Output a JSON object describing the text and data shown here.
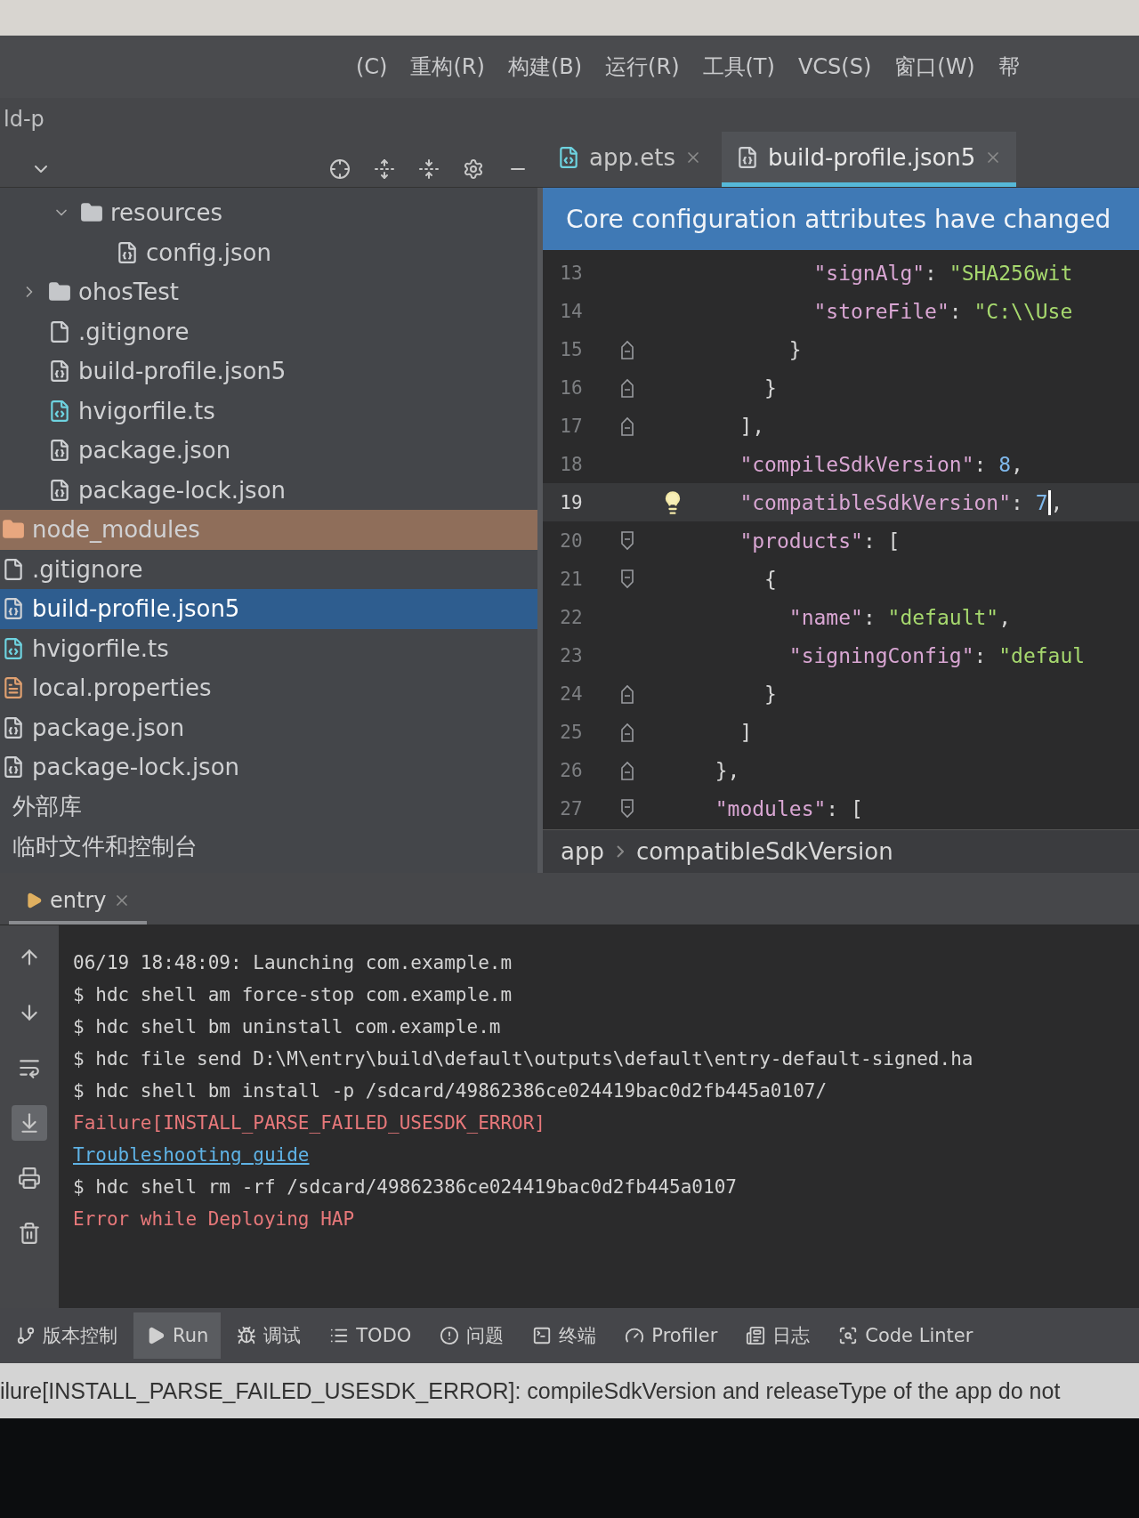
{
  "menu": {
    "project_title": "ld-p",
    "items": [
      "(C)",
      "重构(R)",
      "构建(B)",
      "运行(R)",
      "工具(T)",
      "VCS(S)",
      "窗口(W)",
      "帮"
    ]
  },
  "editor_tabs": [
    {
      "label": "app.ets",
      "kind": "ets",
      "selected": false
    },
    {
      "label": "build-profile.json5",
      "kind": "json",
      "selected": true
    }
  ],
  "tree": {
    "main_items": [
      {
        "label": "resources",
        "kind": "folder",
        "expanded": true,
        "selected": false,
        "children": [
          {
            "label": "config.json",
            "kind": "json",
            "selected": false
          }
        ]
      }
    ],
    "entry_items": [
      {
        "label": "ohosTest",
        "kind": "folder",
        "expanded": false,
        "selected": false
      },
      {
        "label": ".gitignore",
        "kind": "git",
        "selected": false
      },
      {
        "label": "build-profile.json5",
        "kind": "json",
        "selected": false
      },
      {
        "label": "hvigorfile.ts",
        "kind": "ts",
        "selected": false
      },
      {
        "label": "package.json",
        "kind": "json",
        "selected": false
      },
      {
        "label": "package-lock.json",
        "kind": "json",
        "selected": false
      }
    ],
    "root_items": [
      {
        "label": "node_modules",
        "kind": "excluded-folder",
        "selected": false
      },
      {
        "label": ".gitignore",
        "kind": "git",
        "selected": false
      },
      {
        "label": "build-profile.json5",
        "kind": "json",
        "selected": true
      },
      {
        "label": "hvigorfile.ts",
        "kind": "ts",
        "selected": false
      },
      {
        "label": "local.properties",
        "kind": "properties",
        "selected": false
      },
      {
        "label": "package.json",
        "kind": "json",
        "selected": false
      },
      {
        "label": "package-lock.json",
        "kind": "json",
        "selected": false
      }
    ],
    "extra_items": [
      {
        "label": "外部库",
        "selected": false
      },
      {
        "label": "临时文件和控制台",
        "selected": false
      }
    ]
  },
  "banner": "Core configuration attributes have changed",
  "code_lines": [
    {
      "number": "13",
      "kind": "plain",
      "text": "          \"signAlg\": \"SHA256wit",
      "current": false
    },
    {
      "number": "14",
      "kind": "plain",
      "text": "          \"storeFile\": \"C:\\\\Use",
      "current": false
    },
    {
      "number": "15",
      "kind": "fold-end",
      "text": "        }",
      "current": false
    },
    {
      "number": "16",
      "kind": "fold-end",
      "text": "      }",
      "current": false
    },
    {
      "number": "17",
      "kind": "fold-end",
      "text": "    ],",
      "current": false
    },
    {
      "number": "18",
      "kind": "plain",
      "text": "    \"compileSdkVersion\": 8,",
      "current": false
    },
    {
      "number": "19",
      "kind": "plain",
      "text": "    \"compatibleSdkVersion\": 7",
      "after_caret": ",",
      "current": true,
      "intention": true
    },
    {
      "number": "20",
      "kind": "fold-start",
      "text": "    \"products\": [",
      "current": false
    },
    {
      "number": "21",
      "kind": "fold-start",
      "text": "      {",
      "current": false
    },
    {
      "number": "22",
      "kind": "plain",
      "text": "        \"name\": \"default\",",
      "current": false
    },
    {
      "number": "23",
      "kind": "plain",
      "text": "        \"signingConfig\": \"defaul",
      "current": false
    },
    {
      "number": "24",
      "kind": "fold-end",
      "text": "      }",
      "current": false
    },
    {
      "number": "25",
      "kind": "fold-end",
      "text": "    ]",
      "current": false
    },
    {
      "number": "26",
      "kind": "fold-end",
      "text": "  },",
      "current": false
    },
    {
      "number": "27",
      "kind": "fold-start",
      "text": "  \"modules\": [",
      "current": false
    }
  ],
  "breadcrumb": [
    "app",
    "compatibleSdkVersion"
  ],
  "run_tab": {
    "label": "entry",
    "selected": true
  },
  "console": {
    "autoscroll": true,
    "lines": [
      {
        "kind": "text",
        "text": "06/19 18:48:09: Launching com.example.m"
      },
      {
        "kind": "text",
        "text": "$ hdc shell am force-stop com.example.m"
      },
      {
        "kind": "text",
        "text": "$ hdc shell bm uninstall com.example.m"
      },
      {
        "kind": "text",
        "text": "$ hdc file send D:\\M\\entry\\build\\default\\outputs\\default\\entry-default-signed.ha"
      },
      {
        "kind": "text",
        "text": "$ hdc shell bm install -p /sdcard/49862386ce024419bac0d2fb445a0107/"
      },
      {
        "kind": "error",
        "text": "Failure[INSTALL_PARSE_FAILED_USESDK_ERROR]"
      },
      {
        "kind": "link",
        "text": "Troubleshooting guide"
      },
      {
        "kind": "text",
        "text": "$ hdc shell rm -rf /sdcard/49862386ce024419bac0d2fb445a0107"
      },
      {
        "kind": "error",
        "text": "Error while Deploying HAP"
      }
    ]
  },
  "tool_tabs": [
    {
      "label": "版本控制",
      "kind": "vcs",
      "selected": false
    },
    {
      "label": "Run",
      "kind": "run",
      "selected": true
    },
    {
      "label": "调试",
      "kind": "debug",
      "selected": false
    },
    {
      "label": "TODO",
      "kind": "todo",
      "selected": false
    },
    {
      "label": "问题",
      "kind": "problems",
      "selected": false
    },
    {
      "label": "终端",
      "kind": "terminal",
      "selected": false
    },
    {
      "label": "Profiler",
      "kind": "profiler",
      "selected": false
    },
    {
      "label": "日志",
      "kind": "log",
      "selected": false
    },
    {
      "label": "Code Linter",
      "kind": "linter",
      "selected": false
    }
  ],
  "status_bar": "ilure[INSTALL_PARSE_FAILED_USESDK_ERROR]: compileSdkVersion and releaseType of the app do not"
}
